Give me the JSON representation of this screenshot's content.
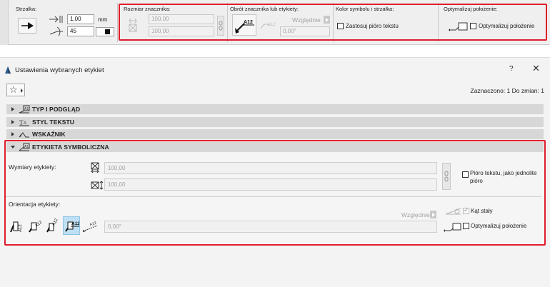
{
  "toolbar": {
    "arrow": {
      "label": "Strzałka:",
      "size_value": "1,00",
      "size_unit": "mm",
      "angle_value": "45"
    },
    "marker_size": {
      "label": "Rozmiar znacznika:",
      "width_value": "100,00",
      "height_value": "100,00"
    },
    "rotation": {
      "label": "Obrót znacznika lub etykiety:",
      "mode": "Względnie",
      "angle_value": "0,00°"
    },
    "color": {
      "label": "Kolor symbolu i strzałka:",
      "checkbox_label": "Zastosuj pióro tekstu"
    },
    "optimize": {
      "label": "Optymalizuj położenie:",
      "checkbox_label": "Optymalizuj położenie"
    }
  },
  "dialog": {
    "title": "Ustawienia wybranych etykiet",
    "help": "?",
    "close": "✕",
    "selection_info": "Zaznaczono: 1 Do zmian: 1",
    "panels": [
      {
        "label": "TYP I PODGLĄD",
        "expanded": false
      },
      {
        "label": "STYL TEKSTU",
        "expanded": false
      },
      {
        "label": "WSKAŹNIK",
        "expanded": false
      },
      {
        "label": "ETYKIETA SYMBOLICZNA",
        "expanded": true
      }
    ],
    "symbolic": {
      "dims_label": "Wymiary etykiety:",
      "width_value": "100,00",
      "height_value": "100,00",
      "pen_checkbox_label": "Pióro tekstu, jako jednolite pióro",
      "orientation_label": "Orientacja etykiety:",
      "rotation_mode": "Względnie",
      "rotation_value": "0,00°",
      "fixed_angle_label": "Kąt stały",
      "optimize_label": "Optymalizuj położenie"
    }
  },
  "colors": {
    "highlight_red": "#e01d2a",
    "selected_blue": "#bfe0f4"
  }
}
